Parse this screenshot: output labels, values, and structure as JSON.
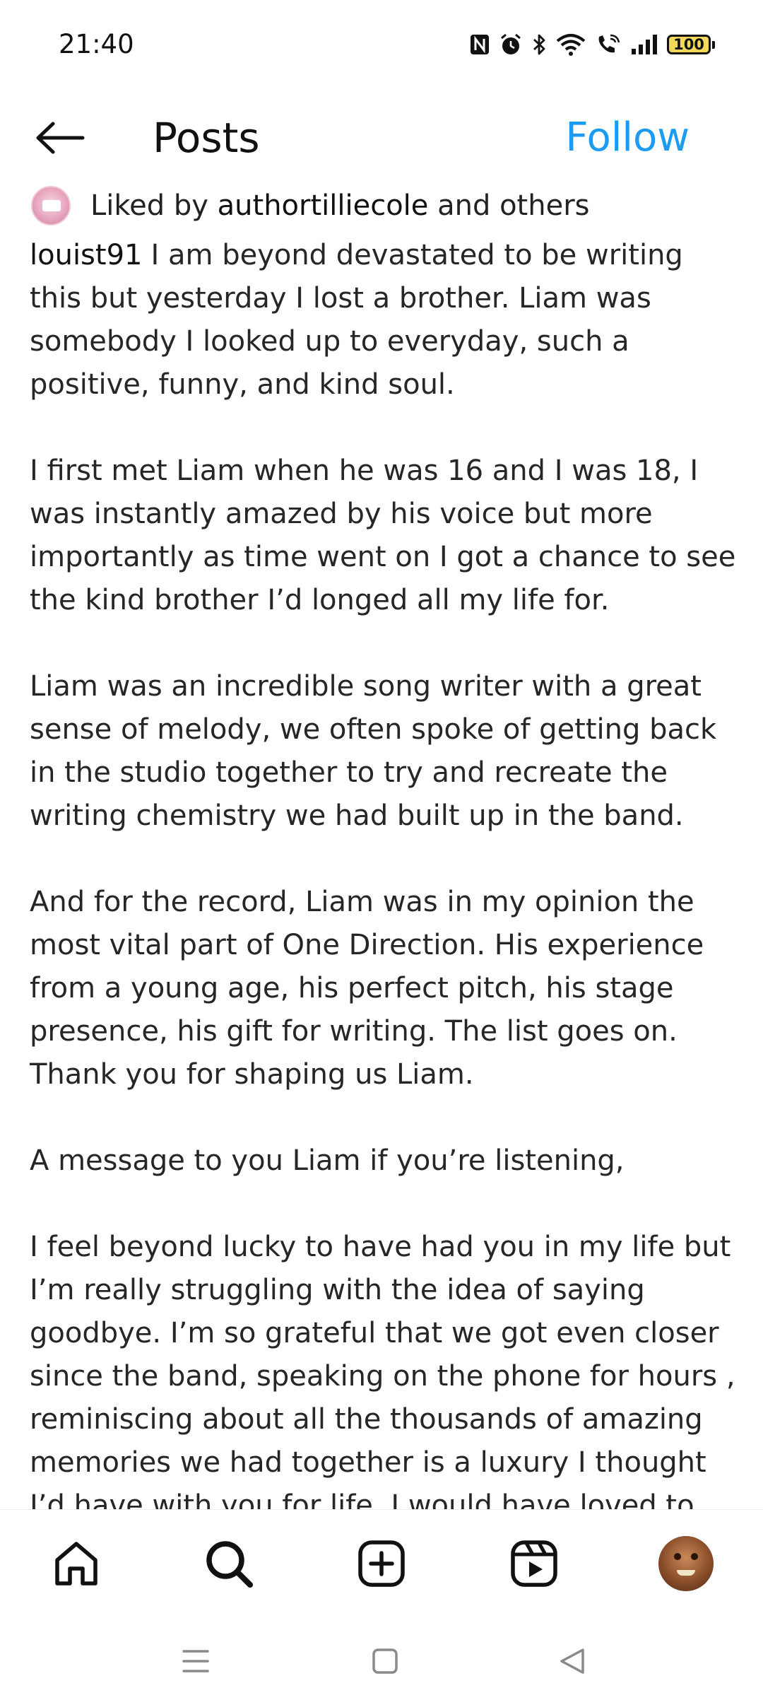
{
  "status_bar": {
    "time": "21:40",
    "battery": "100",
    "icons": [
      "nfc-icon",
      "alarm-icon",
      "bluetooth-icon",
      "wifi-icon",
      "wifi-calling-icon",
      "signal-icon",
      "battery-icon"
    ]
  },
  "header": {
    "title": "Posts",
    "follow_label": "Follow",
    "back_icon": "arrow-left-icon",
    "accent_color": "#1d9bf0"
  },
  "post": {
    "liked_by_prefix": "Liked by",
    "liked_by_user": "authortilliecole",
    "liked_by_suffix": "and others",
    "username": "louist91",
    "caption_paragraphs": [
      "I am beyond devastated to be writing this but yesterday I lost a brother. Liam was somebody I looked up to everyday, such a positive, funny, and kind soul.",
      "I first met Liam when he was 16 and I was 18, I was instantly amazed by his voice but more importantly as time went on I got a chance to see the kind brother I’d longed all my life for.",
      "Liam was an incredible song writer with a great sense of melody, we often spoke of getting back in the studio together to try and recreate the writing chemistry we had built up in the band.",
      "And for the record, Liam was in my opinion the most vital part of One Direction. His experience from a young age, his perfect pitch, his stage presence, his gift for writing. The list goes on. Thank you for shaping us Liam.",
      "A message to you Liam if you’re listening,",
      "I feel beyond lucky to have had you in my life but I’m really struggling with the idea of saying goodbye. I’m so grateful that we got even closer since the band, speaking on the phone for hours , reminiscing about all the thousands of amazing memories we had together is a luxury I thought I’d have with you for life. I would have loved to share the stage with you"
    ]
  },
  "bottom_nav": {
    "items": [
      {
        "name": "home",
        "icon": "home-icon"
      },
      {
        "name": "search",
        "icon": "search-icon"
      },
      {
        "name": "create",
        "icon": "plus-square-icon"
      },
      {
        "name": "reels",
        "icon": "reels-icon"
      },
      {
        "name": "profile",
        "icon": "profile-avatar"
      }
    ]
  },
  "system_nav": {
    "icons": [
      "menu-icon",
      "home-square-icon",
      "back-triangle-icon"
    ]
  }
}
